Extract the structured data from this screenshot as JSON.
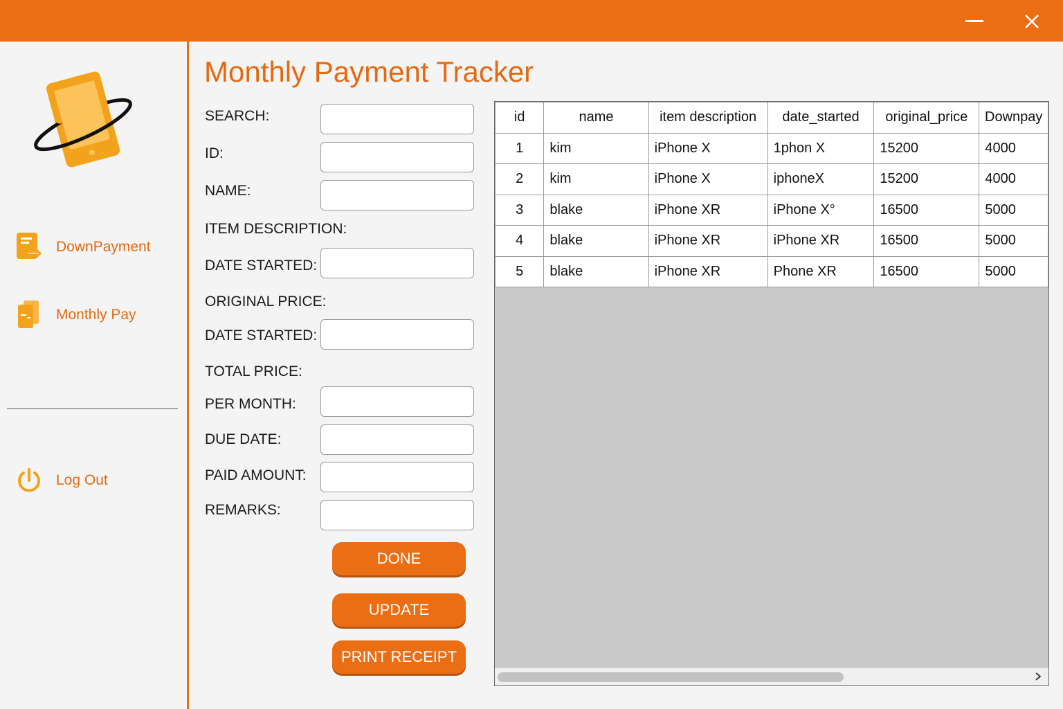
{
  "window": {
    "minimize_icon": "minimize-icon",
    "close_icon": "close-icon",
    "accent_color": "#ec6e14"
  },
  "sidebar": {
    "logo_icon": "phone-orbit-logo",
    "items": [
      {
        "label": "DownPayment",
        "icon": "document-arrow-icon"
      },
      {
        "label": "Monthly Pay",
        "icon": "documents-icon"
      }
    ],
    "logout": {
      "label": "Log Out",
      "icon": "power-icon"
    }
  },
  "main": {
    "title": "Monthly Payment Tracker",
    "form": {
      "search_label": "SEARCH:",
      "id_label": "ID:",
      "name_label": "NAME:",
      "item_description_label": "ITEM DESCRIPTION:",
      "date_started_label": "DATE STARTED:",
      "original_price_label": "ORIGINAL PRICE:",
      "date_started2_label": "DATE STARTED:",
      "total_price_label": "TOTAL PRICE:",
      "per_month_label": "PER MONTH:",
      "due_date_label": "DUE DATE:",
      "paid_amount_label": "PAID AMOUNT:",
      "remarks_label": "REMARKS:"
    },
    "buttons": {
      "done": "DONE",
      "update": "UPDATE",
      "print_receipt": "PRINT RECEIPT"
    }
  },
  "table": {
    "columns": [
      "id",
      "name",
      "item description",
      "date_started",
      "original_price",
      "Downpay"
    ],
    "rows": [
      [
        "1",
        "kim",
        "iPhone X",
        "1phon X",
        "15200",
        "4000"
      ],
      [
        "2",
        "kim",
        "iPhone X",
        "iphoneX",
        "15200",
        "4000"
      ],
      [
        "3",
        "blake",
        "iPhone XR",
        "iPhone X°",
        "16500",
        "5000"
      ],
      [
        "4",
        "blake",
        "iPhone XR",
        "iPhone XR",
        "16500",
        "5000"
      ],
      [
        "5",
        "blake",
        "iPhone XR",
        "Phone XR",
        "16500",
        "5000"
      ]
    ]
  }
}
